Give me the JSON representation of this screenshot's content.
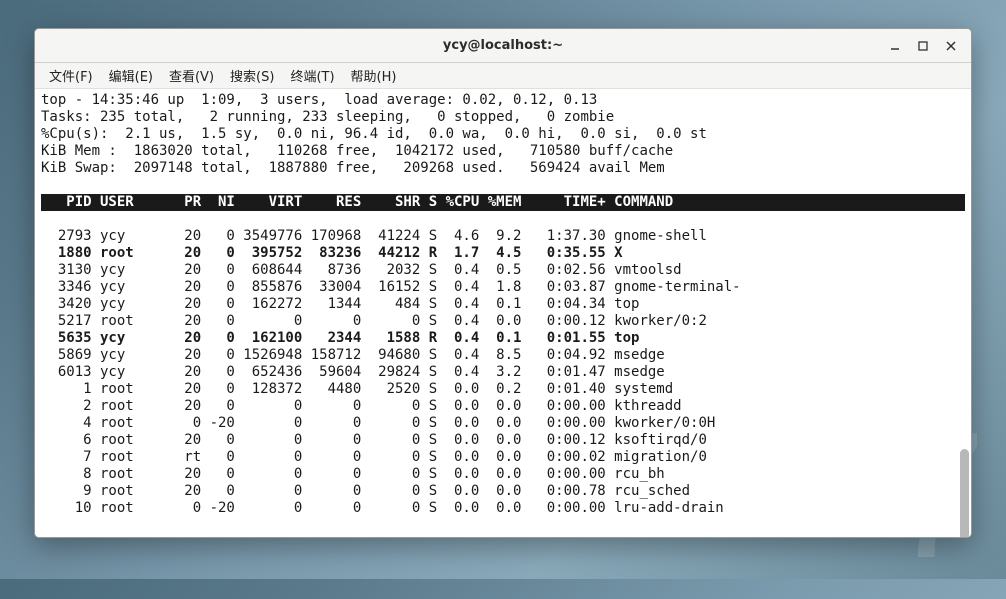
{
  "watermark": "7",
  "window": {
    "title": "ycy@localhost:~"
  },
  "menu": {
    "file": "文件(F)",
    "edit": "编辑(E)",
    "view": "查看(V)",
    "search": "搜索(S)",
    "terminal": "终端(T)",
    "help": "帮助(H)"
  },
  "top": {
    "line1": "top - 14:35:46 up  1:09,  3 users,  load average: 0.02, 0.12, 0.13",
    "line2": "Tasks: 235 total,   2 running, 233 sleeping,   0 stopped,   0 zombie",
    "line3": "%Cpu(s):  2.1 us,  1.5 sy,  0.0 ni, 96.4 id,  0.0 wa,  0.0 hi,  0.0 si,  0.0 st",
    "line4": "KiB Mem :  1863020 total,   110268 free,  1042172 used,   710580 buff/cache",
    "line5": "KiB Swap:  2097148 total,  1887880 free,   209268 used.   569424 avail Mem ",
    "header": "   PID USER      PR  NI    VIRT    RES    SHR S %CPU %MEM     TIME+ COMMAND                            ",
    "rows": [
      {
        "text": "  2793 ycy       20   0 3549776 170968  41224 S  4.6  9.2   1:37.30 gnome-shell",
        "bold": false
      },
      {
        "text": "  1880 root      20   0  395752  83236  44212 R  1.7  4.5   0:35.55 X",
        "bold": true
      },
      {
        "text": "  3130 ycy       20   0  608644   8736   2032 S  0.4  0.5   0:02.56 vmtoolsd",
        "bold": false
      },
      {
        "text": "  3346 ycy       20   0  855876  33004  16152 S  0.4  1.8   0:03.87 gnome-terminal-",
        "bold": false
      },
      {
        "text": "  3420 ycy       20   0  162272   1344    484 S  0.4  0.1   0:04.34 top",
        "bold": false
      },
      {
        "text": "  5217 root      20   0       0      0      0 S  0.4  0.0   0:00.12 kworker/0:2",
        "bold": false
      },
      {
        "text": "  5635 ycy       20   0  162100   2344   1588 R  0.4  0.1   0:01.55 top",
        "bold": true
      },
      {
        "text": "  5869 ycy       20   0 1526948 158712  94680 S  0.4  8.5   0:04.92 msedge",
        "bold": false
      },
      {
        "text": "  6013 ycy       20   0  652436  59604  29824 S  0.4  3.2   0:01.47 msedge",
        "bold": false
      },
      {
        "text": "     1 root      20   0  128372   4480   2520 S  0.0  0.2   0:01.40 systemd",
        "bold": false
      },
      {
        "text": "     2 root      20   0       0      0      0 S  0.0  0.0   0:00.00 kthreadd",
        "bold": false
      },
      {
        "text": "     4 root       0 -20       0      0      0 S  0.0  0.0   0:00.00 kworker/0:0H",
        "bold": false
      },
      {
        "text": "     6 root      20   0       0      0      0 S  0.0  0.0   0:00.12 ksoftirqd/0",
        "bold": false
      },
      {
        "text": "     7 root      rt   0       0      0      0 S  0.0  0.0   0:00.02 migration/0",
        "bold": false
      },
      {
        "text": "     8 root      20   0       0      0      0 S  0.0  0.0   0:00.00 rcu_bh",
        "bold": false
      },
      {
        "text": "     9 root      20   0       0      0      0 S  0.0  0.0   0:00.78 rcu_sched",
        "bold": false
      },
      {
        "text": "    10 root       0 -20       0      0      0 S  0.0  0.0   0:00.00 lru-add-drain",
        "bold": false
      }
    ]
  }
}
